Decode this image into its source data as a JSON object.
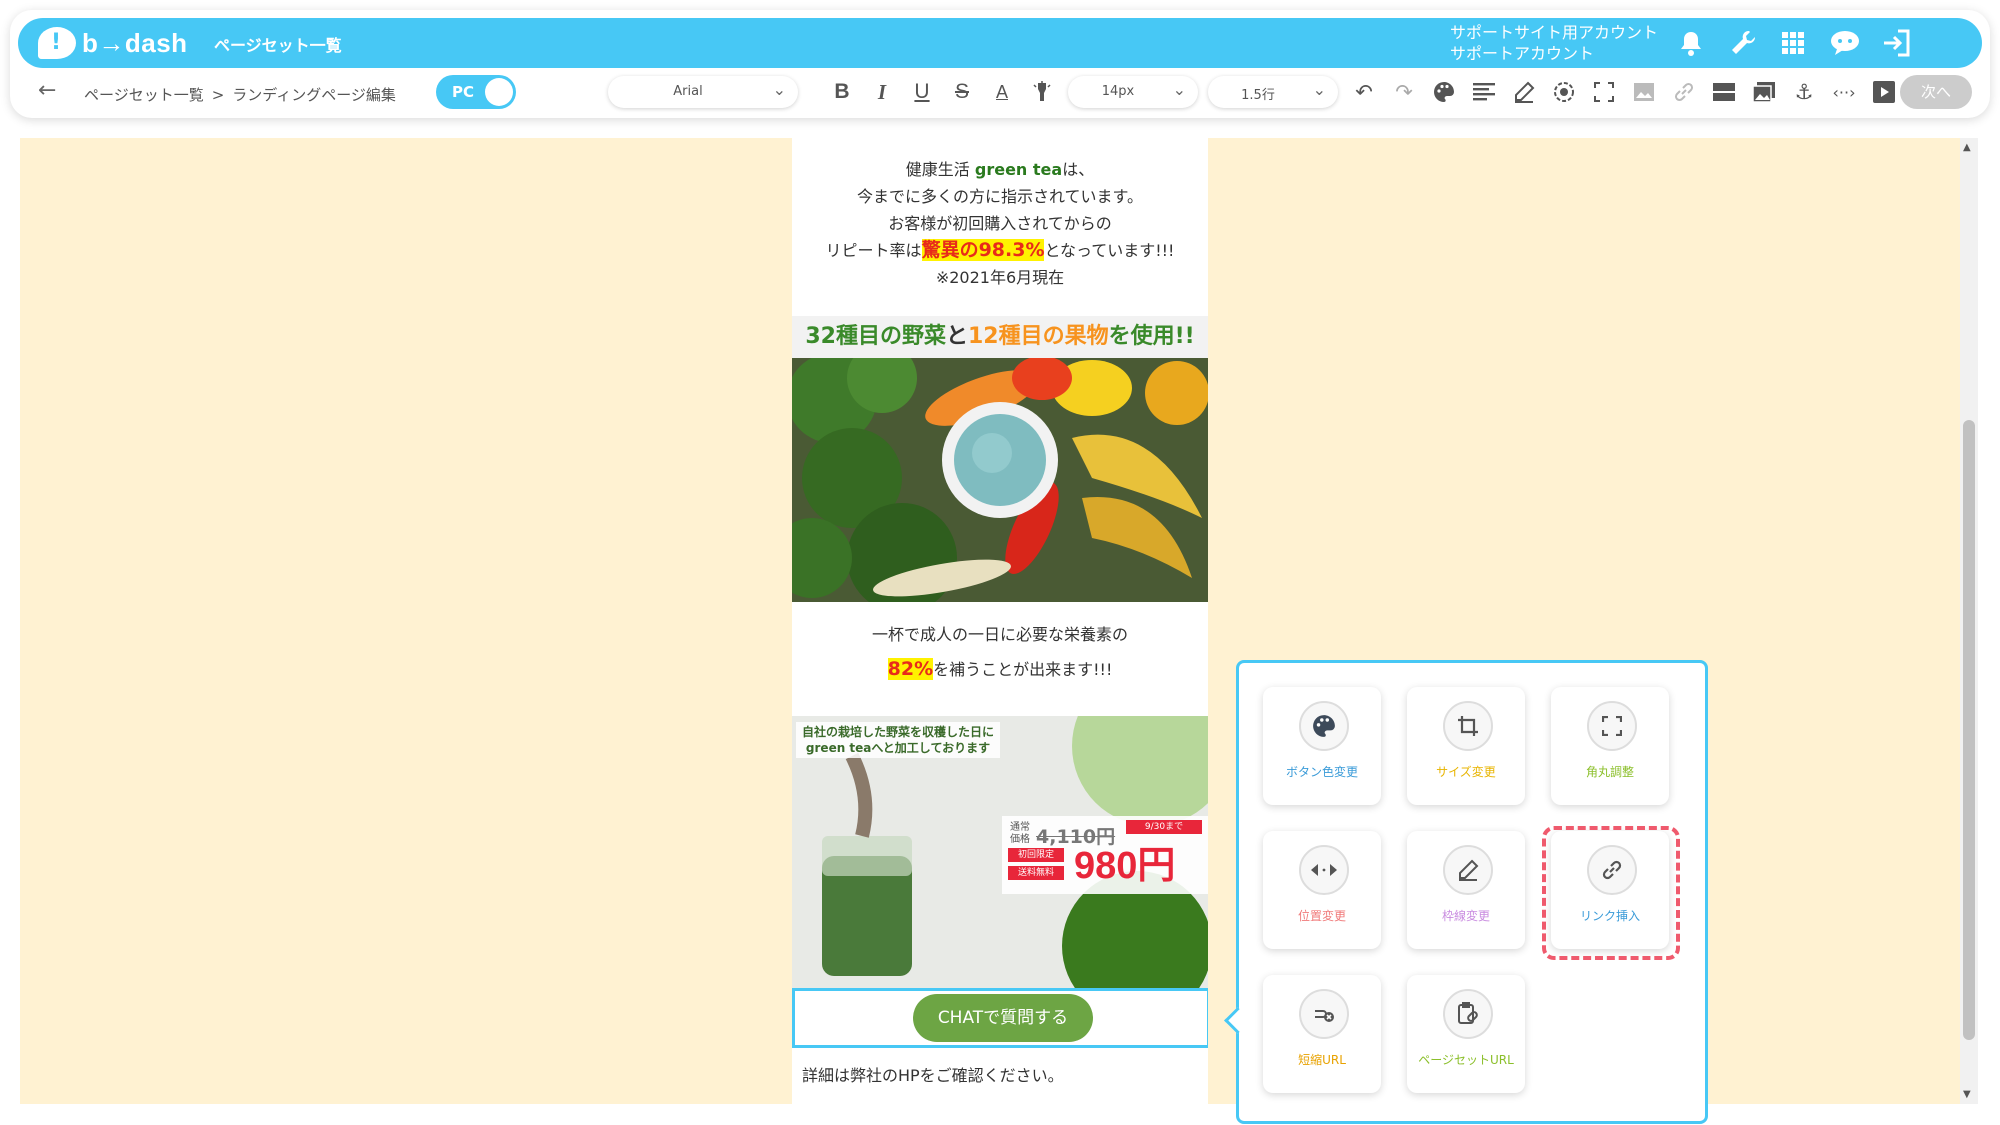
{
  "app": {
    "logo_text": "b→dash",
    "page_title": "ページセット一覧"
  },
  "account": {
    "line1": "サポートサイト用アカウント",
    "line2": "サポートアカウント"
  },
  "header_icons": [
    "bell-icon",
    "wrench-icon",
    "apps-grid-icon",
    "chat-assistant-icon",
    "logout-icon"
  ],
  "breadcrumb": {
    "items": [
      "ページセット一覧",
      "ランディングページ編集"
    ],
    "separator": ">"
  },
  "device_toggle": {
    "label": "PC"
  },
  "toolbar": {
    "font_family": "Arial",
    "font_size": "14px",
    "line_height": "1.5行",
    "next_label": "次へ"
  },
  "toolbar_glyphs": {
    "bold": "B",
    "italic": "I",
    "underline": "U",
    "strike": "S",
    "text_color": "A"
  },
  "lp": {
    "intro": {
      "line1_pre": "健康生活 ",
      "line1_brand": "green tea",
      "line1_post": "は、",
      "line2": "今までに多くの方に指示されています。",
      "line3": "お客様が初回購入されてからの",
      "line4_pre": "リピート率は",
      "line4_hl": "驚異の98.3%",
      "line4_post": "となっています!!!",
      "line5": "※2021年6月現在"
    },
    "veg_banner": {
      "part1": "32種目の野菜",
      "part2": "と",
      "part3": "12種目の果物",
      "part4": "を使用!!"
    },
    "nutrition": {
      "line1": "一杯で成人の一日に必要な栄養素の",
      "hl": "82%",
      "line2_post": "を補うことが出来ます!!!"
    },
    "promo": {
      "caption1": "自社の栽培した野菜を収穫した日に",
      "caption2": "green teaへと加工しております",
      "regular_label1": "通常",
      "regular_label2": "価格",
      "regular_price": "4,110円",
      "until": "9/30まで",
      "badge1": "初回限定",
      "badge2": "送料無料",
      "sale_price": "980円"
    },
    "chat_button": "CHATで質問する",
    "footer_text": "詳細は弊社のHPをご確認ください。"
  },
  "popup": {
    "tiles": [
      {
        "label": "ボタン色変更",
        "icon": "palette-icon",
        "color": "#3a9bd8"
      },
      {
        "label": "サイズ変更",
        "icon": "crop-icon",
        "color": "#e8b400"
      },
      {
        "label": "角丸調整",
        "icon": "corner-radius-icon",
        "color": "#8bbf2a"
      },
      {
        "label": "位置変更",
        "icon": "move-horizontal-icon",
        "color": "#f07a7a"
      },
      {
        "label": "枠線変更",
        "icon": "pen-icon",
        "color": "#c98ce0"
      },
      {
        "label": "リンク挿入",
        "icon": "link-icon",
        "color": "#3a9bd8"
      },
      {
        "label": "短縮URL",
        "icon": "short-link-icon",
        "color": "#e8a200"
      },
      {
        "label": "ページセットURL",
        "icon": "clipboard-link-icon",
        "color": "#8bbf2a"
      }
    ]
  }
}
